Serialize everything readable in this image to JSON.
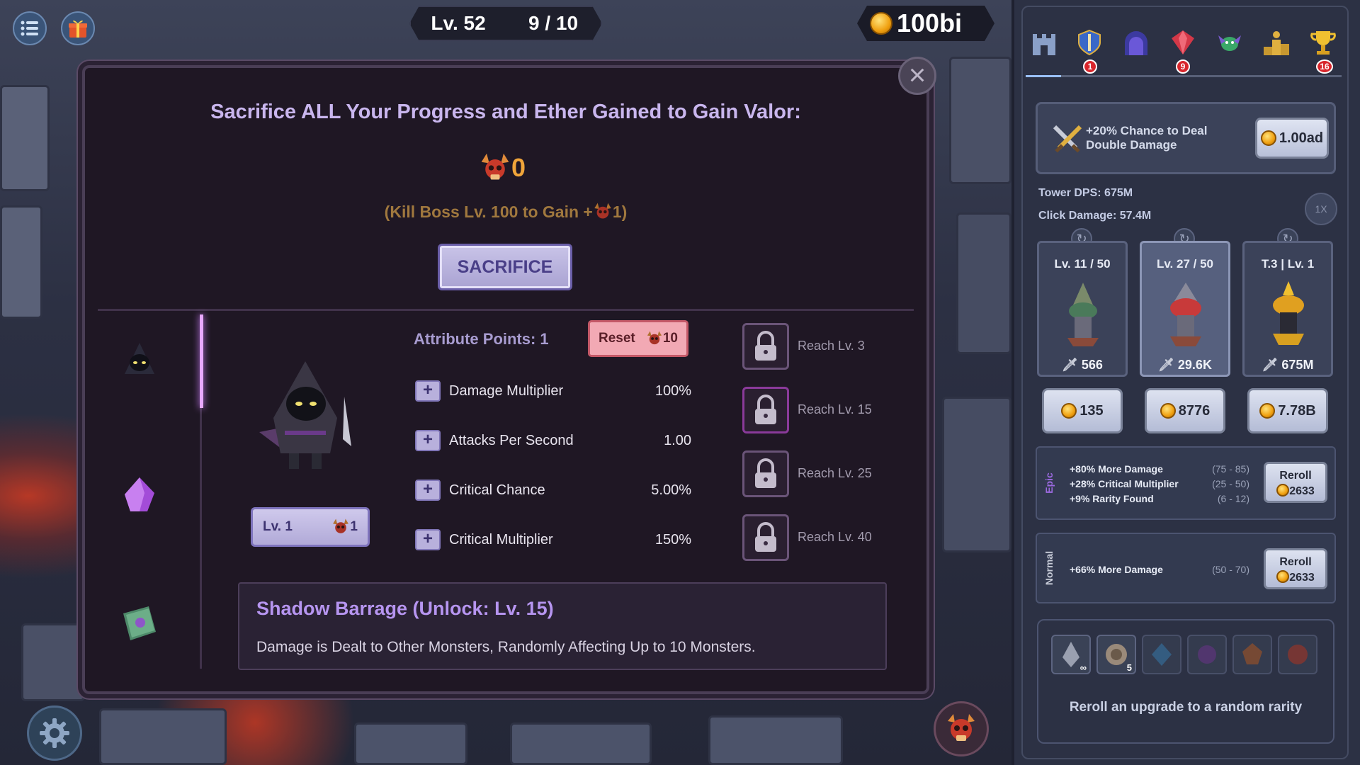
{
  "hud": {
    "level": "Lv. 52",
    "wave": "9 / 10",
    "gold": "100bi"
  },
  "sacrifice_panel": {
    "title": "Sacrifice ALL Your Progress and Ether Gained to Gain Valor:",
    "valor_amount": "0",
    "kill_boss_prefix": "(Kill Boss Lv. 100 to Gain +",
    "kill_boss_suffix": "1)",
    "sacrifice_label": "SACRIFICE"
  },
  "hero": {
    "level_label": "Lv. 1",
    "level_cost": "1",
    "attribute_points": "Attribute Points: 1",
    "reset_label": "Reset",
    "reset_cost": "10",
    "attributes": [
      {
        "name": "Damage Multiplier",
        "value": "100%"
      },
      {
        "name": "Attacks Per Second",
        "value": "1.00"
      },
      {
        "name": "Critical Chance",
        "value": "5.00%"
      },
      {
        "name": "Critical Multiplier",
        "value": "150%"
      }
    ],
    "locks": [
      {
        "label": "Reach Lv. 3"
      },
      {
        "label": "Reach Lv. 15"
      },
      {
        "label": "Reach Lv. 25"
      },
      {
        "label": "Reach Lv. 40"
      }
    ],
    "skill_title": "Shadow Barrage (Unlock: Lv. 15)",
    "skill_desc": "Damage is Dealt to Other Monsters, Randomly Affecting Up to 10 Monsters."
  },
  "right_panel": {
    "tabs": [
      {
        "icon": "castle-icon",
        "badge": ""
      },
      {
        "icon": "shield-sword-icon",
        "badge": "1"
      },
      {
        "icon": "portal-icon",
        "badge": ""
      },
      {
        "icon": "red-gem-icon",
        "badge": "9"
      },
      {
        "icon": "green-creature-icon",
        "badge": ""
      },
      {
        "icon": "podium-icon",
        "badge": ""
      },
      {
        "icon": "trophy-icon",
        "badge": "16"
      }
    ],
    "upgrade": {
      "text_line1": "+20% Chance to Deal",
      "text_line2": "Double Damage",
      "cost": "1.00ad"
    },
    "tower_dps": "Tower DPS: 675M",
    "click_damage": "Click Damage: 57.4M",
    "speed": "1X",
    "towers": [
      {
        "level": "Lv. 11 / 50",
        "damage": "566",
        "cost": "135"
      },
      {
        "level": "Lv. 27 / 50",
        "damage": "29.6K",
        "cost": "8776"
      },
      {
        "level": "T.3 | Lv. 1",
        "damage": "675M",
        "cost": "7.78B"
      }
    ],
    "modifiers": [
      {
        "rarity": "Epic",
        "rarity_color": "#9c6ae0",
        "lines": [
          {
            "text": "+80% More Damage",
            "range": "(75 - 85)"
          },
          {
            "text": "+28% Critical Multiplier",
            "range": "(25 - 50)"
          },
          {
            "text": "+9% Rarity Found",
            "range": "(6 - 12)"
          }
        ],
        "reroll_label": "Reroll",
        "reroll_cost": "2633"
      },
      {
        "rarity": "Normal",
        "rarity_color": "#c8ccd8",
        "lines": [
          {
            "text": "+66% More Damage",
            "range": "(50 - 70)"
          }
        ],
        "reroll_label": "Reroll",
        "reroll_cost": "2633"
      }
    ],
    "inventory": [
      {
        "icon": "grey-shard-icon",
        "count": "∞"
      },
      {
        "icon": "stone-orb-icon",
        "count": "5"
      },
      {
        "icon": "blue-crystal-icon",
        "count": ""
      },
      {
        "icon": "purple-orb-icon",
        "count": ""
      },
      {
        "icon": "orange-gem-icon",
        "count": ""
      },
      {
        "icon": "red-orb-icon",
        "count": ""
      }
    ],
    "reroll_tip": "Reroll an upgrade to a random rarity"
  }
}
